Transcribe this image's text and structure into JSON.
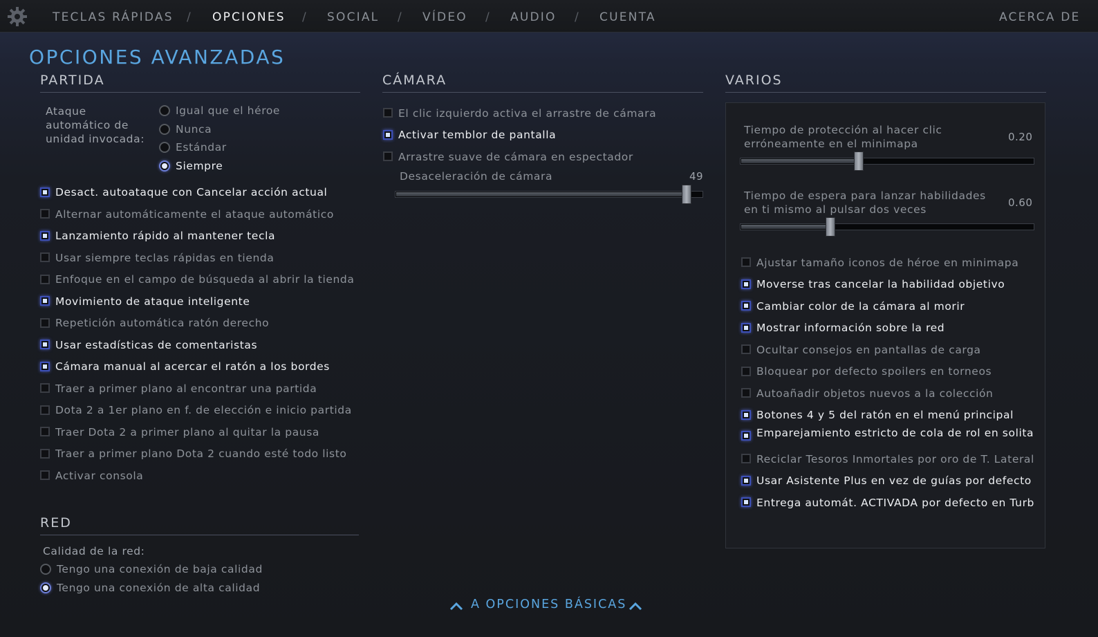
{
  "nav": {
    "items": [
      {
        "label": "TECLAS RÁPIDAS",
        "active": false
      },
      {
        "label": "OPCIONES",
        "active": true
      },
      {
        "label": "SOCIAL",
        "active": false
      },
      {
        "label": "VÍDEO",
        "active": false
      },
      {
        "label": "AUDIO",
        "active": false
      },
      {
        "label": "CUENTA",
        "active": false
      }
    ],
    "separator": "/",
    "about": "ACERCA DE",
    "settings_icon": "gear-icon"
  },
  "page_title": "OPCIONES AVANZADAS",
  "partida": {
    "title": "PARTIDA",
    "autoattack_label": [
      "Ataque",
      "automático de",
      "unidad invocada:"
    ],
    "autoattack_options": [
      {
        "label": "Igual que el héroe",
        "selected": false
      },
      {
        "label": "Nunca",
        "selected": false
      },
      {
        "label": "Estándar",
        "selected": false
      },
      {
        "label": "Siempre",
        "selected": true
      }
    ],
    "checkboxes": [
      {
        "label": "Desact. autoataque con Cancelar acción actual",
        "checked": true
      },
      {
        "label": "Alternar automáticamente el ataque automático",
        "checked": false
      },
      {
        "label": "Lanzamiento rápido al mantener tecla",
        "checked": true
      },
      {
        "label": "Usar siempre teclas rápidas en tienda",
        "checked": false
      },
      {
        "label": "Enfoque en el campo de búsqueda al abrir la tienda",
        "checked": false
      },
      {
        "label": "Movimiento de ataque inteligente",
        "checked": true
      },
      {
        "label": "Repetición automática ratón derecho",
        "checked": false
      },
      {
        "label": "Usar estadísticas de comentaristas",
        "checked": true
      },
      {
        "label": "Cámara manual al acercar el ratón a los bordes",
        "checked": true
      },
      {
        "label": "Traer a primer plano al encontrar una partida",
        "checked": false
      },
      {
        "label": "Dota 2 a 1er plano en f. de elección e inicio partida",
        "checked": false
      },
      {
        "label": "Traer Dota 2 a primer plano al quitar la pausa",
        "checked": false
      },
      {
        "label": "Traer a primer plano Dota 2 cuando esté todo listo",
        "checked": false
      },
      {
        "label": "Activar consola",
        "checked": false
      }
    ]
  },
  "red": {
    "title": "RED",
    "quality_label": "Calidad de la red:",
    "options": [
      {
        "label": "Tengo una conexión de baja calidad",
        "selected": false
      },
      {
        "label": "Tengo una conexión de alta calidad",
        "selected": true
      }
    ]
  },
  "camara": {
    "title": "CÁMARA",
    "checkboxes": [
      {
        "label": "El clic izquierdo activa el arrastre de cámara",
        "checked": false
      },
      {
        "label": "Activar temblor de pantalla",
        "checked": true
      },
      {
        "label": "Arrastre suave de cámara en espectador",
        "checked": false
      }
    ],
    "decel_label": "Desaceleración de cámara",
    "decel_value": "49",
    "decel_fraction": 0.96
  },
  "varios": {
    "title": "VARIOS",
    "slider1_label": [
      "Tiempo de protección al hacer clic",
      "erróneamente en el minimapa"
    ],
    "slider1_value": "0.20",
    "slider1_fraction": 0.4,
    "slider2_label": [
      "Tiempo de espera para lanzar habilidades",
      "en ti mismo al pulsar dos veces"
    ],
    "slider2_value": "0.60",
    "slider2_fraction": 0.3,
    "checkboxes": [
      {
        "label": "Ajustar tamaño iconos de héroe en minimapa",
        "checked": false
      },
      {
        "label": "Moverse tras cancelar la habilidad objetivo",
        "checked": true
      },
      {
        "label": "Cambiar color de la cámara al morir",
        "checked": true
      },
      {
        "label": "Mostrar información sobre la red",
        "checked": true
      },
      {
        "label": "Ocultar consejos en pantallas de carga",
        "checked": false
      },
      {
        "label": "Bloquear por defecto spoilers en torneos",
        "checked": false
      },
      {
        "label": "Autoañadir objetos nuevos a la colección",
        "checked": false
      },
      {
        "label": "Botones 4 y 5 del ratón en el menú principal",
        "checked": true
      },
      {
        "label": "Emparejamiento estricto de cola de rol en solita..",
        "checked": true
      },
      {
        "label": "Reciclar Tesoros Inmortales por oro de T. Lateral",
        "checked": false
      },
      {
        "label": "Usar Asistente Plus en vez de guías por defecto",
        "checked": true
      },
      {
        "label": "Entrega automát. ACTIVADA por defecto en Turb",
        "checked": true
      }
    ]
  },
  "footer": {
    "basic_options_link": "A OPCIONES BÁSICAS",
    "chevron_icon": "chevron-up-icon"
  }
}
